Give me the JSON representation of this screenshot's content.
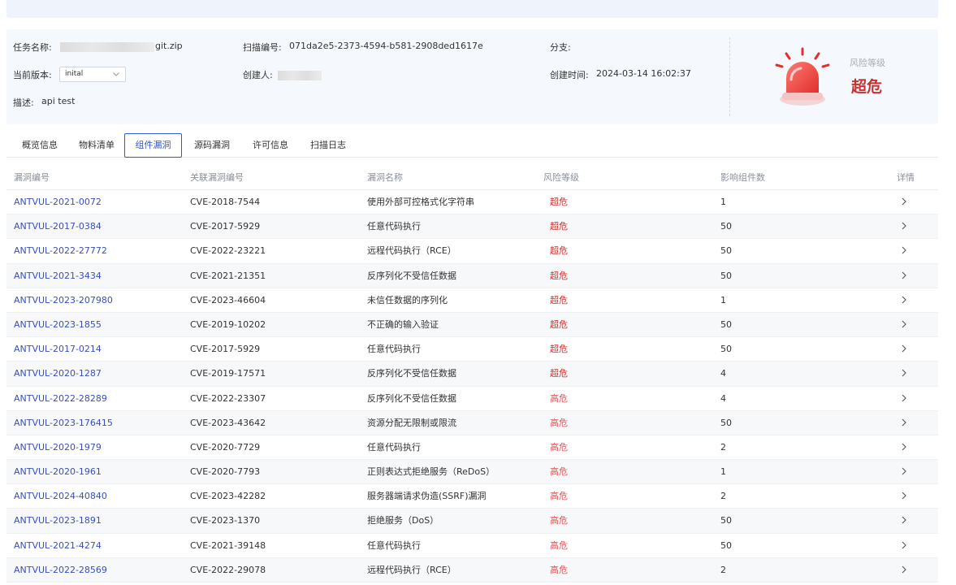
{
  "info": {
    "task_name_label": "任务名称:",
    "task_name_suffix": "git.zip",
    "scan_id_label": "扫描编号:",
    "scan_id_value": "071da2e5-2373-4594-b581-2908ded1617e",
    "branch_label": "分支:",
    "version_label": "当前版本:",
    "version_value": "inital",
    "creator_label": "创建人:",
    "created_time_label": "创建时间:",
    "created_time_value": "2024-03-14 16:02:37",
    "desc_label": "描述:",
    "desc_value": "api test",
    "risk_level_label": "风险等级",
    "risk_level_value": "超危"
  },
  "tabs": [
    "概览信息",
    "物料清单",
    "组件漏洞",
    "源码漏洞",
    "许可信息",
    "扫描日志"
  ],
  "active_tab": "组件漏洞",
  "table": {
    "headers": [
      "漏洞编号",
      "关联漏洞编号",
      "漏洞名称",
      "风险等级",
      "影响组件数",
      "详情"
    ],
    "rows": [
      {
        "id": "ANTVUL-2021-0072",
        "cve": "CVE-2018-7544",
        "name": "使用外部可控格式化字符串",
        "level": "超危",
        "count": "1"
      },
      {
        "id": "ANTVUL-2017-0384",
        "cve": "CVE-2017-5929",
        "name": "任意代码执行",
        "level": "超危",
        "count": "50"
      },
      {
        "id": "ANTVUL-2022-27772",
        "cve": "CVE-2022-23221",
        "name": "远程代码执行（RCE）",
        "level": "超危",
        "count": "50"
      },
      {
        "id": "ANTVUL-2021-3434",
        "cve": "CVE-2021-21351",
        "name": "反序列化不受信任数据",
        "level": "超危",
        "count": "50"
      },
      {
        "id": "ANTVUL-2023-207980",
        "cve": "CVE-2023-46604",
        "name": "未信任数据的序列化",
        "level": "超危",
        "count": "1"
      },
      {
        "id": "ANTVUL-2023-1855",
        "cve": "CVE-2019-10202",
        "name": "不正确的输入验证",
        "level": "超危",
        "count": "50"
      },
      {
        "id": "ANTVUL-2017-0214",
        "cve": "CVE-2017-5929",
        "name": "任意代码执行",
        "level": "超危",
        "count": "50"
      },
      {
        "id": "ANTVUL-2020-1287",
        "cve": "CVE-2019-17571",
        "name": "反序列化不受信任数据",
        "level": "超危",
        "count": "4"
      },
      {
        "id": "ANTVUL-2022-28289",
        "cve": "CVE-2022-23307",
        "name": "反序列化不受信任数据",
        "level": "高危",
        "count": "4"
      },
      {
        "id": "ANTVUL-2023-176415",
        "cve": "CVE-2023-43642",
        "name": "资源分配无限制或限流",
        "level": "高危",
        "count": "50"
      },
      {
        "id": "ANTVUL-2020-1979",
        "cve": "CVE-2020-7729",
        "name": "任意代码执行",
        "level": "高危",
        "count": "2"
      },
      {
        "id": "ANTVUL-2020-1961",
        "cve": "CVE-2020-7793",
        "name": "正则表达式拒绝服务（ReDoS）",
        "level": "高危",
        "count": "1"
      },
      {
        "id": "ANTVUL-2024-40840",
        "cve": "CVE-2023-42282",
        "name": "服务器端请求伪造(SSRF)漏洞",
        "level": "高危",
        "count": "2"
      },
      {
        "id": "ANTVUL-2023-1891",
        "cve": "CVE-2023-1370",
        "name": "拒绝服务（DoS）",
        "level": "高危",
        "count": "50"
      },
      {
        "id": "ANTVUL-2021-4274",
        "cve": "CVE-2021-39148",
        "name": "任意代码执行",
        "level": "高危",
        "count": "50"
      },
      {
        "id": "ANTVUL-2022-28569",
        "cve": "CVE-2022-29078",
        "name": "远程代码执行（RCE）",
        "level": "高危",
        "count": "2"
      }
    ]
  },
  "colors": {
    "accent": "#2f5bd9",
    "link": "#3a4fb8",
    "critical": "#c8312f",
    "high": "#e0555a"
  }
}
